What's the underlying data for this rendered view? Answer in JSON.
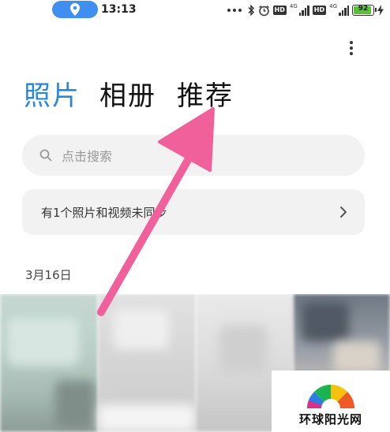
{
  "status_bar": {
    "time": "13:13",
    "network_hd_1": "HD",
    "network_hd_2": "HD",
    "net_type_1": "4G",
    "net_type_2": "4G",
    "battery": "92"
  },
  "tabs": [
    {
      "label": "照片",
      "active": true
    },
    {
      "label": "相册",
      "active": false
    },
    {
      "label": "推荐",
      "active": false
    }
  ],
  "search": {
    "placeholder": "点击搜索"
  },
  "sync_banner": {
    "text": "有1个照片和视频未同步"
  },
  "section": {
    "date": "3月16日"
  },
  "watermark": {
    "text": "环球阳光网"
  },
  "colors": {
    "accent": "#2a86d6",
    "arrow": "#f0609a",
    "location_pill": "#3f8ff0",
    "battery": "#5bbf3a"
  },
  "icons": [
    "location-icon",
    "bluetooth-icon",
    "alarm-icon",
    "signal-icon",
    "battery-icon",
    "more-icon",
    "search-icon",
    "chevron-right-icon"
  ]
}
